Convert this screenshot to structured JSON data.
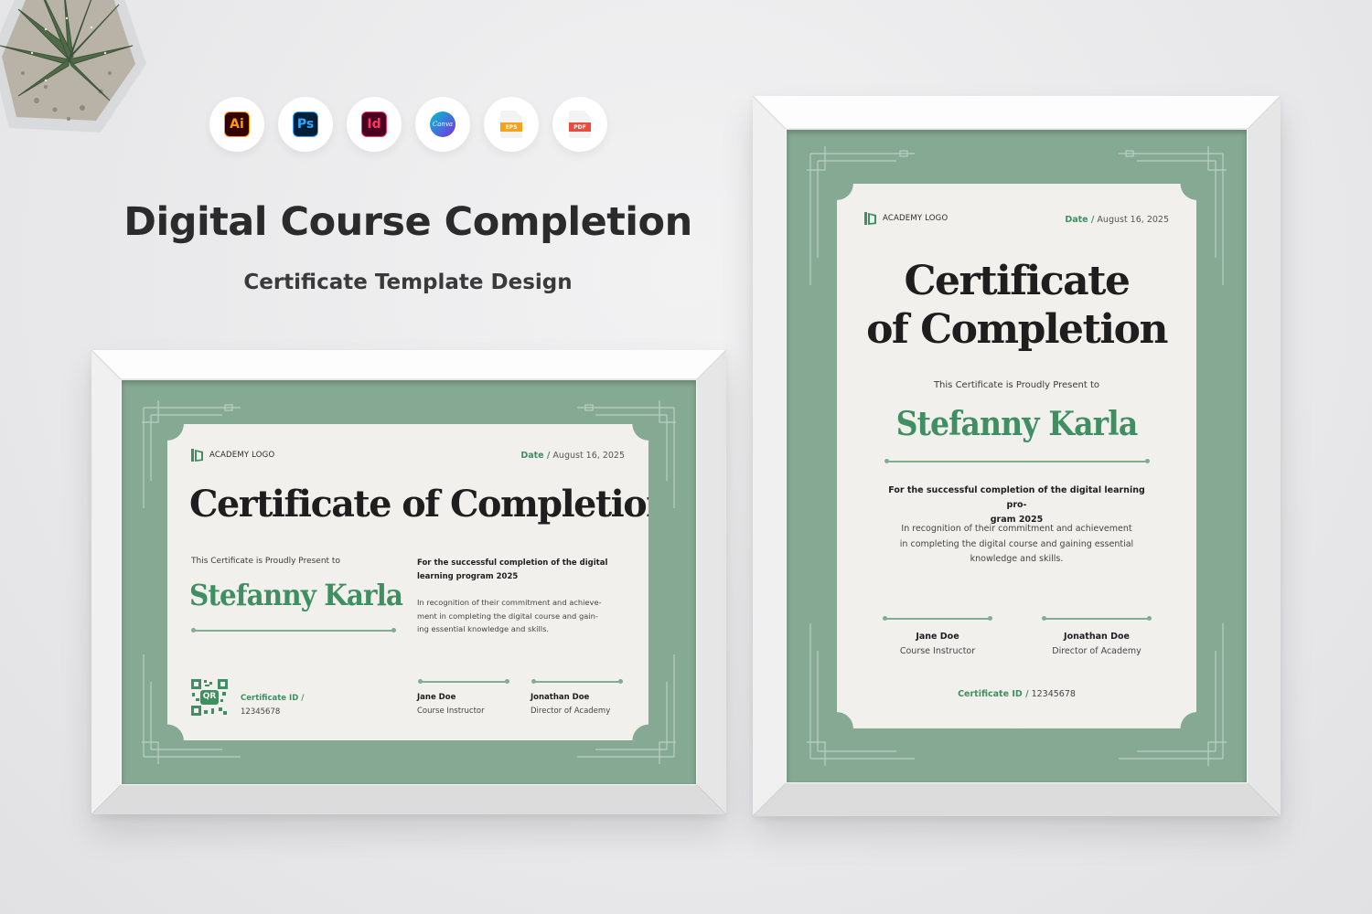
{
  "header": {
    "title": "Digital Course Completion",
    "subtitle": "Certificate Template Design"
  },
  "software_icons": [
    {
      "name": "illustrator-icon",
      "label": "Ai"
    },
    {
      "name": "photoshop-icon",
      "label": "Ps"
    },
    {
      "name": "indesign-icon",
      "label": "Id"
    },
    {
      "name": "canva-icon",
      "label": "Canva"
    },
    {
      "name": "eps-file-icon",
      "label": "EPS"
    },
    {
      "name": "pdf-file-icon",
      "label": "PDF"
    }
  ],
  "certificate": {
    "logo_text": "ACADEMY LOGO",
    "date_label": "Date /",
    "date_value": "August 16, 2025",
    "title": "Certificate of Completion",
    "title_line1": "Certificate",
    "title_line2": "of Completion",
    "present_text": "This Certificate is Proudly Present to",
    "recipient": "Stefanny Karla",
    "completion_text": "For the successful completion of the digital learning program 2025",
    "completion_text_landscape_1": "For the successful completion of the digital",
    "completion_text_landscape_2": "learning program 2025",
    "completion_text_portrait_1": "For the successful completion of the digital learning pro-",
    "completion_text_portrait_2": "gram 2025",
    "recognition_landscape_1": "In recognition of their commitment and achieve-",
    "recognition_landscape_2": "ment in completing the digital course and gain-",
    "recognition_landscape_3": "ing essential knowledge and skills.",
    "recognition_portrait_1": "In recognition of their commitment and achievement",
    "recognition_portrait_2": "in completing the digital course and gaining essential",
    "recognition_portrait_3": "knowledge and skills.",
    "signer1_name": "Jane Doe",
    "signer1_role": "Course Instructor",
    "signer2_name": "Jonathan Doe",
    "signer2_role": "Director of Academy",
    "cert_id_label": "Certificate ID /",
    "cert_id_value": "12345678",
    "qr_label": "QR"
  },
  "colors": {
    "accent_green": "#3f8f62",
    "frame_mat_green": "#85a993",
    "paper": "#f2f0ec",
    "background": "#e7e7e9"
  }
}
